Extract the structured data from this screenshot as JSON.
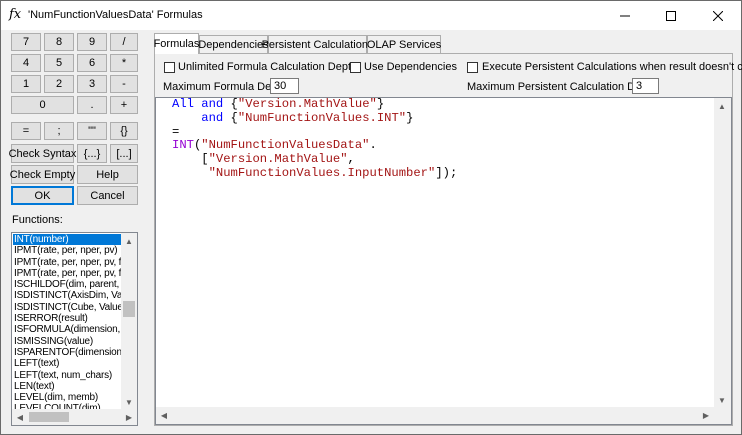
{
  "window": {
    "title": "'NumFunctionValuesData' Formulas",
    "icon_text": "fx",
    "icon": "function-icon",
    "controls": {
      "minimize": "minimize-icon",
      "maximize": "maximize-icon",
      "close": "close-icon"
    }
  },
  "keypad": {
    "keys": [
      "7",
      "8",
      "9",
      "/",
      "4",
      "5",
      "6",
      "*",
      "1",
      "2",
      "3",
      "-",
      "0",
      ".",
      "+",
      "=",
      ";",
      "\"\"",
      "{}"
    ],
    "check_syntax": "Check Syntax",
    "brace_set": "{...}",
    "bracket_set": "[...]",
    "check_empty": "Check Empty",
    "help": "Help",
    "ok": "OK",
    "cancel": "Cancel"
  },
  "functions": {
    "label": "Functions:",
    "items": [
      "INT(number)",
      "IPMT(rate, per, nper, pv)",
      "IPMT(rate, per, nper, pv, fv",
      "IPMT(rate, per, nper, pv, fv",
      "ISCHILDOF(dim, parent, ch",
      "ISDISTINCT(AxisDim, Valu",
      "ISDISTINCT(Cube, Value, /",
      "ISERROR(result)",
      "ISFORMULA(dimension, me",
      "ISMISSING(value)",
      "ISPARENTOF(dimension, c",
      "LEFT(text)",
      "LEFT(text, num_chars)",
      "LEN(text)",
      "LEVEL(dim, memb)",
      "LEVELCOUNT(dim)"
    ],
    "selected_index": 0
  },
  "tabs": [
    {
      "label": "Formulas",
      "active": true
    },
    {
      "label": "Dependencies",
      "active": false
    },
    {
      "label": "Persistent Calculations",
      "active": false
    },
    {
      "label": "OLAP Services",
      "active": false
    }
  ],
  "options": {
    "unlimited_depth_label": "Unlimited Formula Calculation Depth",
    "unlimited_depth_checked": false,
    "use_dependencies_label": "Use Dependencies",
    "use_dependencies_checked": false,
    "execute_persistent_label": "Execute Persistent Calculations when result doesn't change",
    "execute_persistent_checked": false,
    "max_depth_label": "Maximum Formula Depth:",
    "max_depth_value": "30",
    "max_persistent_label": "Maximum Persistent Calculation Depth:",
    "max_persistent_value": "3"
  },
  "editor": {
    "lines": [
      [
        {
          "t": "All",
          "c": "kw"
        },
        {
          "t": " ",
          "c": "op"
        },
        {
          "t": "and",
          "c": "kw"
        },
        {
          "t": " {",
          "c": "op"
        },
        {
          "t": "\"Version.MathValue\"",
          "c": "str"
        },
        {
          "t": "}",
          "c": "op"
        }
      ],
      [
        {
          "t": "    ",
          "c": "op"
        },
        {
          "t": "and",
          "c": "kw"
        },
        {
          "t": " {",
          "c": "op"
        },
        {
          "t": "\"NumFunctionValues.INT\"",
          "c": "str"
        },
        {
          "t": "}",
          "c": "op"
        }
      ],
      [
        {
          "t": "=",
          "c": "op"
        }
      ],
      [
        {
          "t": "INT",
          "c": "fn"
        },
        {
          "t": "(",
          "c": "op"
        },
        {
          "t": "\"NumFunctionValuesData\"",
          "c": "str"
        },
        {
          "t": ".",
          "c": "op"
        }
      ],
      [
        {
          "t": "    [",
          "c": "op"
        },
        {
          "t": "\"Version.MathValue\"",
          "c": "str"
        },
        {
          "t": ",",
          "c": "op"
        }
      ],
      [
        {
          "t": "     ",
          "c": "op"
        },
        {
          "t": "\"NumFunctionValues.InputNumber\"",
          "c": "str"
        },
        {
          "t": "]);",
          "c": "op"
        }
      ]
    ]
  }
}
